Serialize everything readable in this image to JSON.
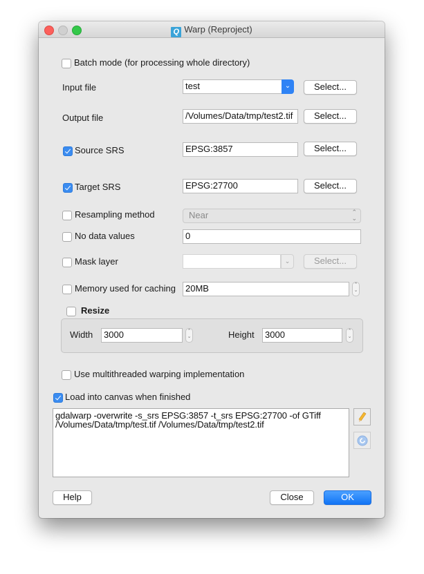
{
  "window": {
    "title": "Warp (Reproject)",
    "app_icon": "qgis-logo-icon"
  },
  "batch_mode": {
    "label": "Batch mode (for processing whole directory)",
    "checked": false
  },
  "input_file": {
    "label": "Input file",
    "value": "test",
    "select_label": "Select..."
  },
  "output_file": {
    "label": "Output file",
    "value": "/Volumes/Data/tmp/test2.tif",
    "select_label": "Select..."
  },
  "source_srs": {
    "label": "Source SRS",
    "checked": true,
    "value": "EPSG:3857",
    "select_label": "Select..."
  },
  "target_srs": {
    "label": "Target SRS",
    "checked": true,
    "value": "EPSG:27700",
    "select_label": "Select..."
  },
  "resampling": {
    "label": "Resampling method",
    "checked": false,
    "value": "Near"
  },
  "no_data": {
    "label": "No data values",
    "checked": false,
    "value": "0"
  },
  "mask_layer": {
    "label": "Mask layer",
    "checked": false,
    "value": "",
    "select_label": "Select..."
  },
  "memory": {
    "label": "Memory used for caching",
    "checked": false,
    "value": "20MB"
  },
  "resize": {
    "label": "Resize",
    "checked": false,
    "width_label": "Width",
    "width_value": "3000",
    "height_label": "Height",
    "height_value": "3000"
  },
  "multithread": {
    "label": "Use multithreaded warping implementation",
    "checked": false
  },
  "load_canvas": {
    "label": "Load into canvas when finished",
    "checked": true
  },
  "command": {
    "text": "gdalwarp -overwrite -s_srs EPSG:3857 -t_srs EPSG:27700 -of GTiff\n/Volumes/Data/tmp/test.tif /Volumes/Data/tmp/test2.tif"
  },
  "footer": {
    "help_label": "Help",
    "close_label": "Close",
    "ok_label": "OK"
  },
  "colors": {
    "accent": "#1274f5",
    "checkbox_checked": "#3b8cf0"
  }
}
